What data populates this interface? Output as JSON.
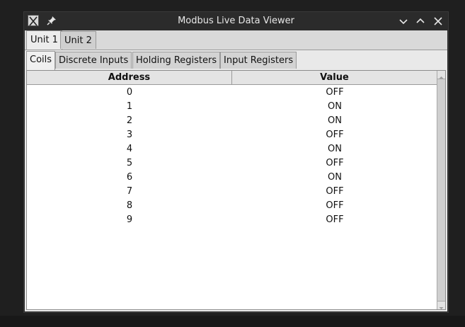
{
  "window": {
    "title": "Modbus Live Data Viewer",
    "icon": "x11-app-icon"
  },
  "titlebar_buttons": [
    "pin-icon",
    "minimize-icon",
    "maximize-icon",
    "close-icon"
  ],
  "unit_tabs": [
    {
      "label": "Unit 1",
      "active": true
    },
    {
      "label": "Unit 2",
      "active": false
    }
  ],
  "data_tabs": [
    {
      "label": "Coils",
      "active": true
    },
    {
      "label": "Discrete Inputs",
      "active": false
    },
    {
      "label": "Holding Registers",
      "active": false
    },
    {
      "label": "Input Registers",
      "active": false
    }
  ],
  "table": {
    "columns": [
      "Address",
      "Value"
    ],
    "rows": [
      [
        "0",
        "OFF"
      ],
      [
        "1",
        "ON"
      ],
      [
        "2",
        "ON"
      ],
      [
        "3",
        "OFF"
      ],
      [
        "4",
        "ON"
      ],
      [
        "5",
        "OFF"
      ],
      [
        "6",
        "ON"
      ],
      [
        "7",
        "OFF"
      ],
      [
        "8",
        "OFF"
      ],
      [
        "9",
        "OFF"
      ]
    ]
  },
  "colors": {
    "titlebar": "#2b2b2b",
    "client": "#dcdcdc",
    "table_bg": "#ffffff"
  }
}
